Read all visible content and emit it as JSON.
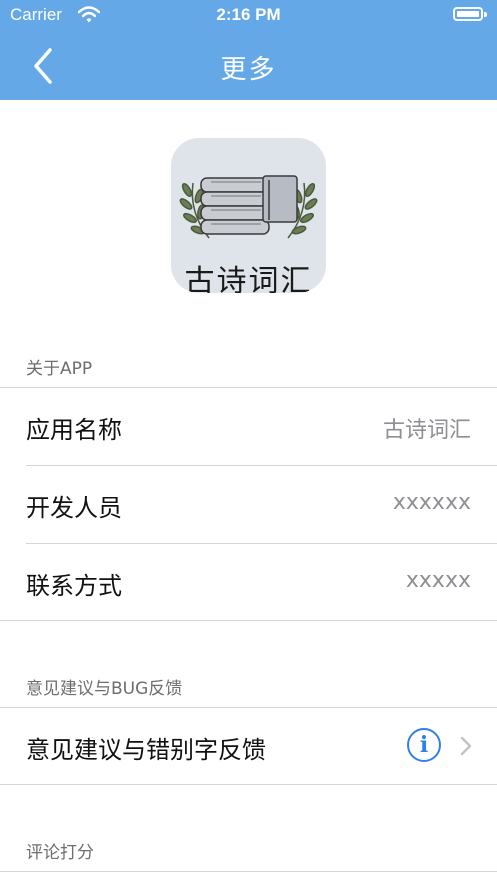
{
  "status_bar": {
    "carrier": "Carrier",
    "time": "2:16 PM"
  },
  "nav": {
    "title": "更多"
  },
  "app_icon": {
    "text": "古诗词汇"
  },
  "sections": {
    "about": {
      "header": "关于APP",
      "rows": [
        {
          "label": "应用名称",
          "value": "古诗词汇"
        },
        {
          "label": "开发人员",
          "value": "xxxxxx"
        },
        {
          "label": "联系方式",
          "value": "xxxxx"
        }
      ]
    },
    "feedback": {
      "header": "意见建议与BUG反馈",
      "row_label": "意见建议与错别字反馈"
    },
    "rating": {
      "header": "评论打分"
    }
  },
  "colors": {
    "nav_background": "#64a8e8",
    "accent": "#2f7ff0"
  }
}
